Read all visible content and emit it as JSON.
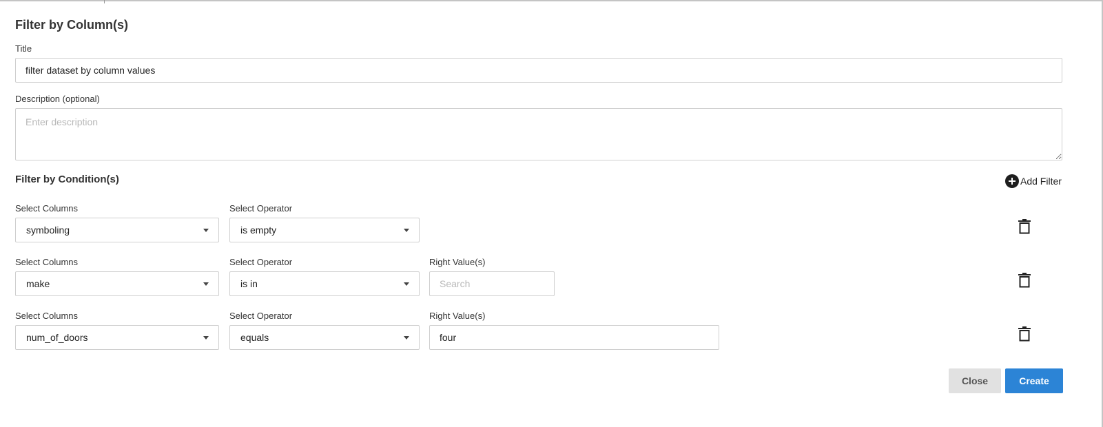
{
  "dialog": {
    "title": "Filter by Column(s)"
  },
  "title_field": {
    "label": "Title",
    "value": "filter dataset by column values"
  },
  "description_field": {
    "label": "Description (optional)",
    "placeholder": "Enter description"
  },
  "conditions": {
    "title": "Filter by Condition(s)",
    "add_filter_label": "Add Filter",
    "rows": [
      {
        "column_label": "Select Columns",
        "column_value": "symboling",
        "operator_label": "Select Operator",
        "operator_value": "is empty"
      },
      {
        "column_label": "Select Columns",
        "column_value": "make",
        "operator_label": "Select Operator",
        "operator_value": "is in",
        "right_label": "Right Value(s)",
        "right_placeholder": "Search"
      },
      {
        "column_label": "Select Columns",
        "column_value": "num_of_doors",
        "operator_label": "Select Operator",
        "operator_value": "equals",
        "right_label": "Right Value(s)",
        "right_value": "four"
      }
    ]
  },
  "footer": {
    "close_label": "Close",
    "create_label": "Create"
  },
  "colors": {
    "primary": "#2c84d6",
    "secondary_button": "#e1e1e1",
    "border": "#cfcfcf"
  },
  "icons": {
    "add": "plus-circle-icon",
    "delete": "trash-icon",
    "dropdown": "caret-down-icon"
  }
}
